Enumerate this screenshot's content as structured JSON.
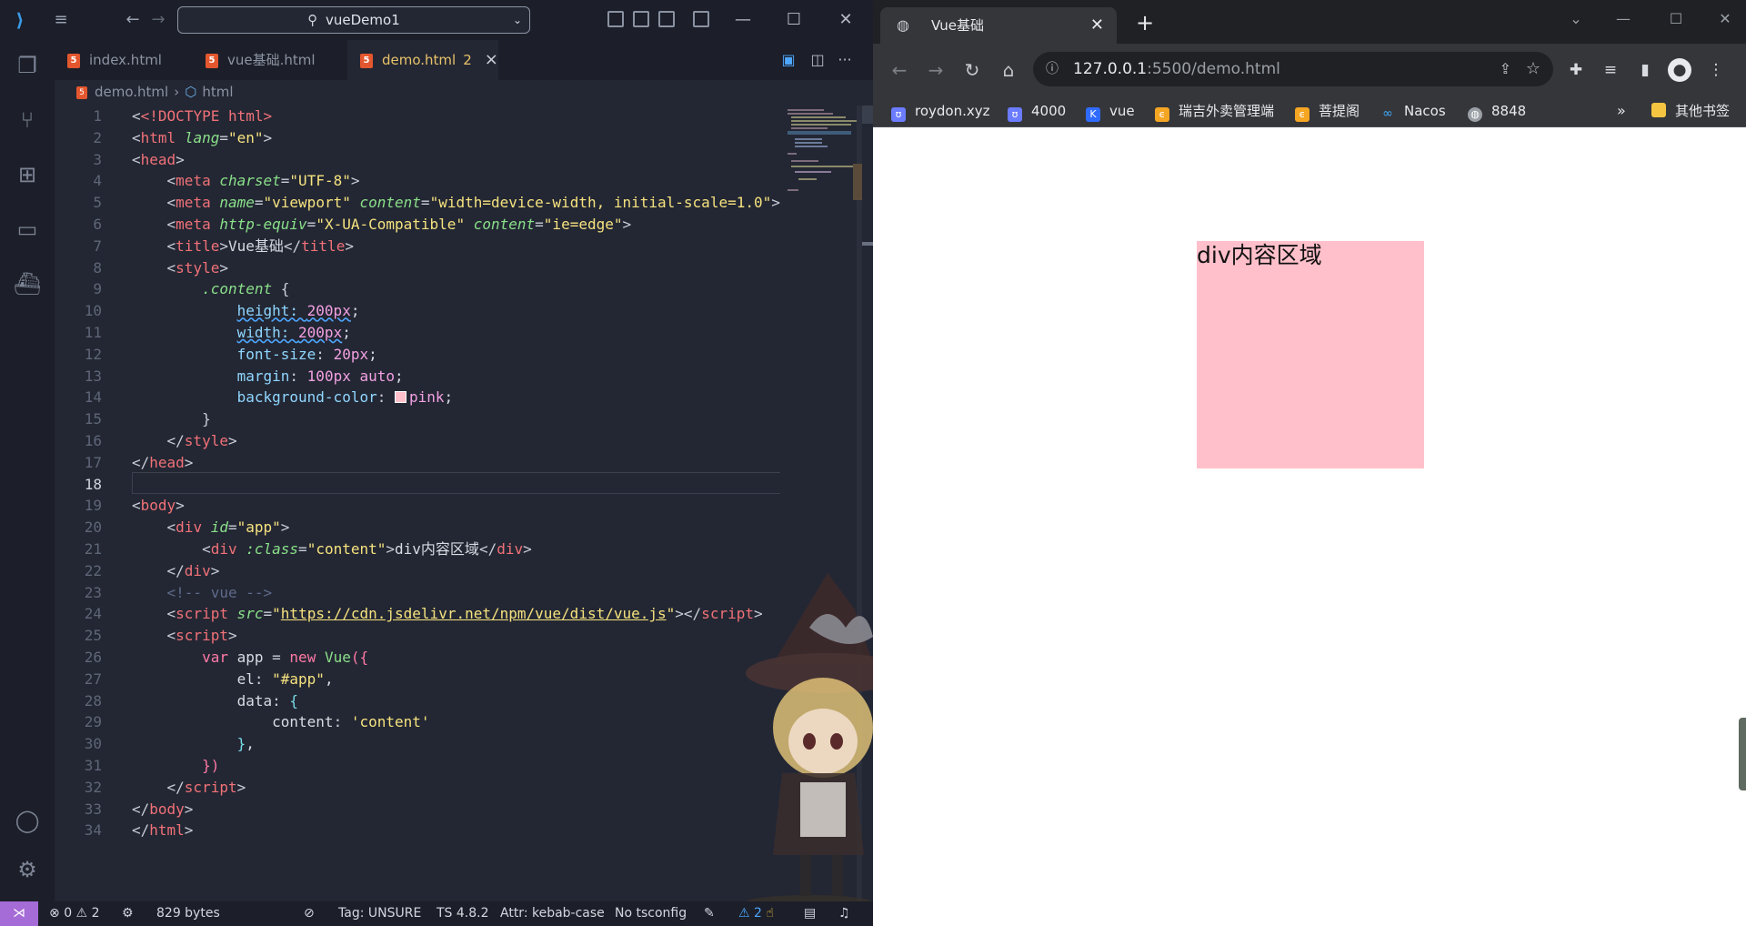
{
  "vscode": {
    "search_text": "vueDemo1",
    "tabs": [
      {
        "label": "index.html"
      },
      {
        "label": "vue基础.html"
      },
      {
        "label": "demo.html",
        "badge": "2"
      }
    ],
    "breadcrumb": [
      "demo.html",
      "html"
    ],
    "current_line": 18,
    "code_lines": [
      "1",
      "2",
      "3",
      "4",
      "5",
      "6",
      "7",
      "8",
      "9",
      "10",
      "11",
      "12",
      "13",
      "14",
      "15",
      "16",
      "17",
      "18",
      "19",
      "20",
      "21",
      "22",
      "23",
      "24",
      "25",
      "26",
      "27",
      "28",
      "29",
      "30",
      "31",
      "32",
      "33",
      "34"
    ],
    "code": {
      "l1": "<!DOCTYPE html>",
      "l5_content": "\"width=device-width, initial-scale=1.0\"",
      "l6_equiv": "\"X-UA-Compatible\"",
      "l7_title": "Vue基础",
      "l21_text": "div内容区域",
      "l23_comment": "<!-- vue -->",
      "l24_src": "https://cdn.jsdelivr.net/npm/vue/dist/vue.js",
      "l29_content": "'content'"
    },
    "status": {
      "errors": "0",
      "warnings": "2",
      "size": "829 bytes",
      "tag": "Tag: UNSURE",
      "ts": "TS 4.8.2",
      "attr": "Attr: kebab-case",
      "tsconfig": "No tsconfig",
      "alerts": "2"
    }
  },
  "chrome": {
    "tab_title": "Vue基础",
    "url_host": "127.0.0.1",
    "url_rest": ":5500/demo.html",
    "bookmarks": [
      {
        "label": "roydon.xyz",
        "color": "#6b7cff"
      },
      {
        "label": "4000",
        "color": "#6b7cff"
      },
      {
        "label": "vue",
        "color": "#2f6bff"
      },
      {
        "label": "瑞吉外卖管理端",
        "color": "#f5a623"
      },
      {
        "label": "菩提阁",
        "color": "#f5a623"
      },
      {
        "label": "Nacos",
        "color": "#3fa9f5"
      },
      {
        "label": "8848",
        "color": "#9aa0a6"
      }
    ],
    "other_bookmarks": "其他书签",
    "page_box_text": "div内容区域",
    "page_box_color": "pink"
  }
}
